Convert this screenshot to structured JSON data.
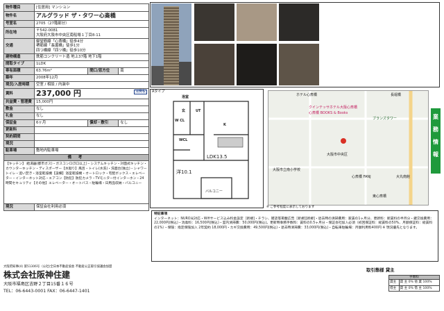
{
  "header": {
    "label_name": "物件種目",
    "value_name": "[住居用] マンション"
  },
  "rows": [
    {
      "label": "物件名",
      "value": "アルグラッド ザ・タワー心斎橋"
    },
    {
      "label": "号室名",
      "value": "2705（27階部分）"
    },
    {
      "label": "所在地",
      "value1": "〒542-0081",
      "value2": "大阪府大阪市中央区南船場１丁目8-11"
    },
    {
      "label": "交通",
      "lines": [
        "御堂筋線「心斎橋」徒歩4分",
        "堺筋線「長堀橋」徒歩1分",
        "四つ橋線「四ツ橋」徒歩10分"
      ]
    },
    {
      "label": "建物構造",
      "value": "鉄筋コンクリート造 地上37階 地下1階"
    },
    {
      "label": "間取タイプ",
      "value": "1LDK"
    },
    {
      "label": "専有面積",
      "value": "63.76m²",
      "label2": "間口/窓方位",
      "value2": "南"
    },
    {
      "label": "築年",
      "value": "2008年12月"
    },
    {
      "label": "現況/入居時期",
      "value": "空室 / 相談 / 内装中"
    },
    {
      "label": "賃料",
      "value": "237,000 円",
      "tag": "消費税"
    },
    {
      "label": "共益費・管理費",
      "value": "15,000円"
    },
    {
      "label": "敷金",
      "value": "なし"
    },
    {
      "label": "礼金",
      "value": "なし"
    },
    {
      "label": "保証金",
      "value": "6ヶ月",
      "label2": "償却・敷引",
      "value2": "なし"
    },
    {
      "label": "更新料",
      "value": ""
    },
    {
      "label": "契約期間",
      "value": ""
    },
    {
      "label": "現況",
      "value": ""
    },
    {
      "label": "駐車場",
      "value": "敷地内駐車場"
    }
  ],
  "remarks": {
    "title": "備 考",
    "text": "【キッチン】 給湯器(都市ガス)・ガスコンロ(3口以上)・システムキッチン・対面式キッチン・カウンターキッチン・ディスポーザー【水廻り】風呂・トイレ(水洗)・洗面台(独立)・シャワートイレ・追い焚き・浴室乾燥機【設備】浴室乾燥機・オートロック・宅配ボックス・エレベーター・インターネット対応・エアコン【防犯】防犯カメラ・TVモニター付インターホン・24時間セキュリティ【その他】エレベーター・オートバス・駐輪場・日用品収納・バルコニー"
  },
  "status": {
    "label": "現況",
    "value": "保証会社利用必須"
  },
  "floorplan": {
    "type_label": "Aタイプ",
    "rooms": {
      "bath": "浴室",
      "ut": "UT",
      "genkan": "玄",
      "wcl1": "W CL",
      "wcl2": "WCL",
      "k": "K",
      "ldk": "LDK13.5",
      "yo": "洋10.1",
      "balcony": "バルコニー"
    }
  },
  "map": {
    "labels": [
      "ホテル心斎橋",
      "クインテッサホテル大阪心斎橋",
      "心斎橋 BOOKS & Books",
      "長堀橋",
      "ブランズタワー",
      "大阪市立南小学校",
      "大阪市中央区",
      "心斎橋 FANJ",
      "大丸南館",
      "東心斎橋"
    ],
    "note": "※ ご参考程度に表示しております"
  },
  "note_header": "特記事項",
  "notes": "インターネット：NURO光対応・Wifiサービス込み料金設定［新規]・チラシ、雑誌等掲載広告［新規][新規]・退去時の清掃費用：家賃の1ヶ月分、更新料：新賃料の半月分・鍵交換費用：22,000円(税込)・消毒料：16,500円(税込)・室内清掃費：50,000円(税込)。更新時事務手数料：賃料の0.5ヶ月分・保証会社加入必須（初回保証料：総賃料の50%、月額保証料：総賃料の1%）・保険：指定保険加入 2年契約 18,000円・カギ交換費用：49,500円(税込)・退去時清掃費：33,000円(税込)・自転車駐輪場：月額利用料400円 ※ 現況優先となります。",
  "sidebar_text": "業務情報",
  "footer": {
    "license": "大阪府知事(4) 第51306号（公社)全日本不動産協会 不動産公正取引協議会加盟",
    "company": "株式会社阪神住建",
    "address": "大阪市福島区吉野２丁目15番１６号",
    "tel": "TEL：06-6443-0001 FAX：06-6447-1401"
  },
  "fee": {
    "title": "取引態様 貸主",
    "header": "手数料",
    "rows": [
      [
        "貸主",
        "貸 主 0% 他 業 100%"
      ],
      [
        "借主",
        "貸 主 0% 借 主 100%"
      ]
    ]
  },
  "colors": {
    "gray": "#d9d9d9",
    "green": "#1f9a3c",
    "blue": "#1a3d8a"
  }
}
